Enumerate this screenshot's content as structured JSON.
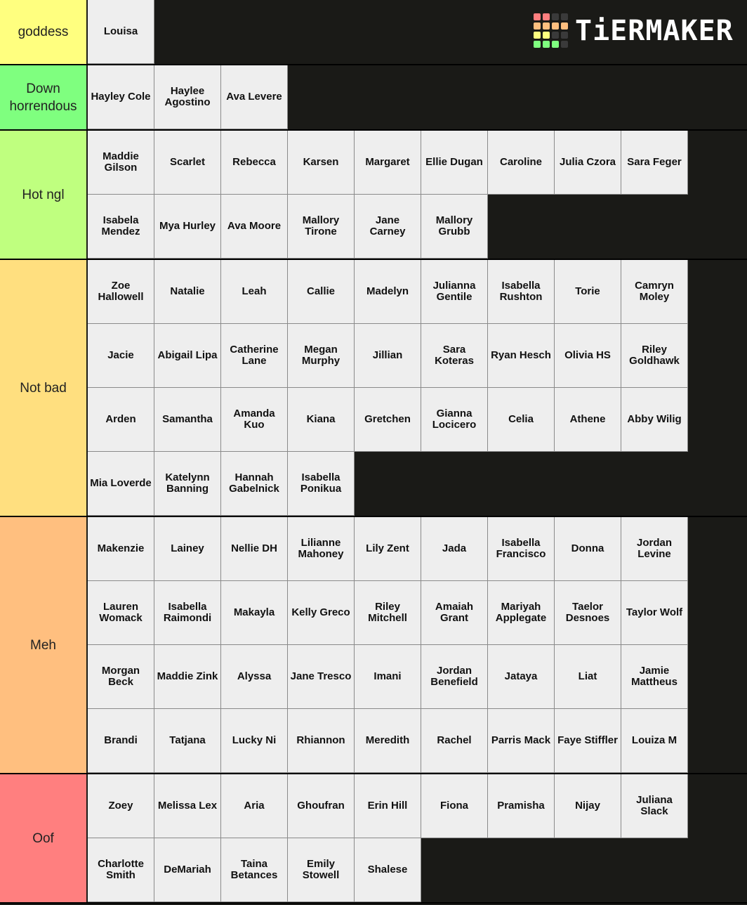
{
  "logo": {
    "text": "TiERMAKER",
    "colors": [
      "#ff7f7f",
      "#ff7f7f",
      "#3a3a3a",
      "#3a3a3a",
      "#ffbf7f",
      "#ffbf7f",
      "#ffbf7f",
      "#ffbf7f",
      "#ffff7f",
      "#ffff7f",
      "#3a3a3a",
      "#3a3a3a",
      "#7fff7f",
      "#7fff7f",
      "#7fff7f",
      "#3a3a3a"
    ]
  },
  "tiers": [
    {
      "label": "goddess",
      "color": "#ffff7f",
      "items": [
        "Louisa"
      ]
    },
    {
      "label": "Down horrendous",
      "color": "#7fff7f",
      "items": [
        "Hayley Cole",
        "Haylee Agostino",
        "Ava Levere"
      ]
    },
    {
      "label": "Hot ngl",
      "color": "#bfff7f",
      "items": [
        "Maddie Gilson",
        "Scarlet",
        "Rebecca",
        "Karsen",
        "Margaret",
        "Ellie Dugan",
        "Caroline",
        "Julia Czora",
        "Sara Feger",
        "Isabela Mendez",
        "Mya Hurley",
        "Ava Moore",
        "Mallory Tirone",
        "Jane Carney",
        "Mallory Grubb"
      ]
    },
    {
      "label": "Not bad",
      "color": "#ffdf7f",
      "items": [
        "Zoe Hallowell",
        "Natalie",
        "Leah",
        "Callie",
        "Madelyn",
        "Julianna Gentile",
        "Isabella Rushton",
        "Torie",
        "Camryn Moley",
        "Jacie",
        "Abigail Lipa",
        "Catherine Lane",
        "Megan Murphy",
        "Jillian",
        "Sara Koteras",
        "Ryan Hesch",
        "Olivia HS",
        "Riley Goldhawk",
        "Arden",
        "Samantha",
        "Amanda Kuo",
        "Kiana",
        "Gretchen",
        "Gianna Locicero",
        "Celia",
        "Athene",
        "Abby Wilig",
        "Mia Loverde",
        "Katelynn Banning",
        "Hannah Gabelnick",
        "Isabella Ponikua"
      ]
    },
    {
      "label": "Meh",
      "color": "#ffbf7f",
      "items": [
        "Makenzie",
        "Lainey",
        "Nellie DH",
        "Lilianne Mahoney",
        "Lily Zent",
        "Jada",
        "Isabella Francisco",
        "Donna",
        "Jordan Levine",
        "Lauren Womack",
        "Isabella Raimondi",
        "Makayla",
        "Kelly Greco",
        "Riley Mitchell",
        "Amaiah Grant",
        "Mariyah Applegate",
        "Taelor Desnoes",
        "Taylor Wolf",
        "Morgan Beck",
        "Maddie Zink",
        "Alyssa",
        "Jane Tresco",
        "Imani",
        "Jordan Benefield",
        "Jataya",
        "Liat",
        "Jamie Mattheus",
        "Brandi",
        "Tatjana",
        "Lucky Ni",
        "Rhiannon",
        "Meredith",
        "Rachel",
        "Parris Mack",
        "Faye Stiffler",
        "Louiza M"
      ]
    },
    {
      "label": "Oof",
      "color": "#ff7f7f",
      "items": [
        "Zoey",
        "Melissa Lex",
        "Aria",
        "Ghoufran",
        "Erin Hill",
        "Fiona",
        "Pramisha",
        "Nijay",
        "Juliana Slack",
        "Charlotte Smith",
        "DeMariah",
        "Taina Betances",
        "Emily Stowell",
        "Shalese"
      ]
    }
  ]
}
